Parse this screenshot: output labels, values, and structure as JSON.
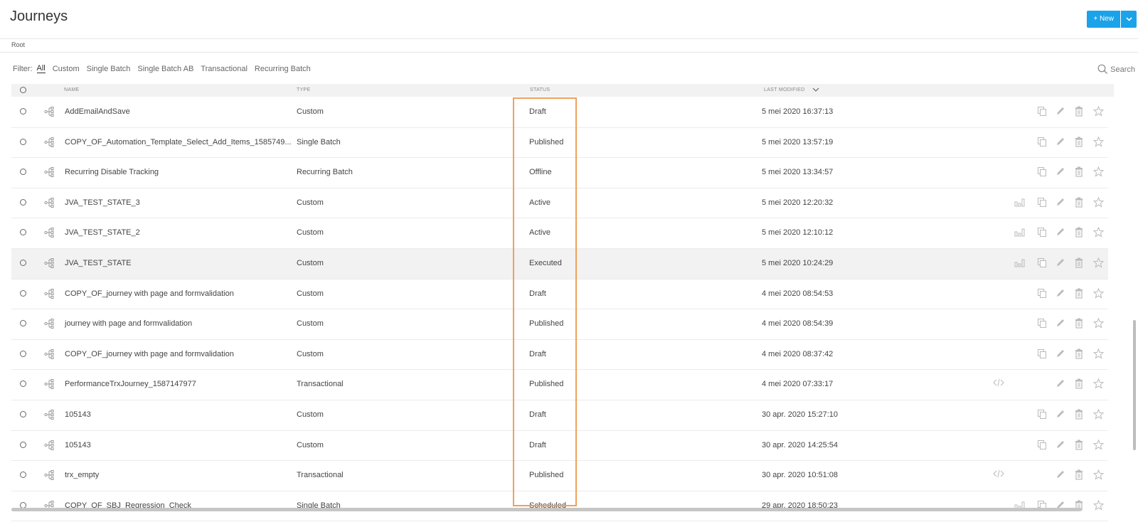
{
  "header": {
    "title": "Journeys",
    "new_button": "+ New"
  },
  "breadcrumb": "Root",
  "filter": {
    "label": "Filter:",
    "options": [
      "All",
      "Custom",
      "Single Batch",
      "Single Batch AB",
      "Transactional",
      "Recurring Batch"
    ],
    "active": "All"
  },
  "search": {
    "label": "Search"
  },
  "columns": {
    "name": "NAME",
    "type": "TYPE",
    "status": "STATUS",
    "last_modified": "LAST MODIFIED"
  },
  "colors": {
    "accent": "#1aa3e8",
    "highlight_box": "#f0a05a"
  },
  "rows": [
    {
      "name": "AddEmailAndSave",
      "type": "Custom",
      "status": "Draft",
      "modified": "5 mei 2020 16:37:13",
      "icons": [
        "copy",
        "edit",
        "delete",
        "star"
      ]
    },
    {
      "name": "COPY_OF_Automation_Template_Select_Add_Items_1585749...",
      "type": "Single Batch",
      "status": "Published",
      "modified": "5 mei 2020 13:57:19",
      "icons": [
        "copy",
        "edit",
        "delete",
        "star"
      ]
    },
    {
      "name": "Recurring Disable Tracking",
      "type": "Recurring Batch",
      "status": "Offline",
      "modified": "5 mei 2020 13:34:57",
      "icons": [
        "copy",
        "edit",
        "delete",
        "star"
      ]
    },
    {
      "name": "JVA_TEST_STATE_3",
      "type": "Custom",
      "status": "Active",
      "modified": "5 mei 2020 12:20:32",
      "icons": [
        "stats",
        "copy",
        "edit",
        "delete",
        "star"
      ]
    },
    {
      "name": "JVA_TEST_STATE_2",
      "type": "Custom",
      "status": "Active",
      "modified": "5 mei 2020 12:10:12",
      "icons": [
        "stats",
        "copy",
        "edit",
        "delete",
        "star"
      ]
    },
    {
      "name": "JVA_TEST_STATE",
      "type": "Custom",
      "status": "Executed",
      "modified": "5 mei 2020 10:24:29",
      "icons": [
        "stats",
        "copy",
        "edit",
        "delete",
        "star"
      ],
      "highlight": true
    },
    {
      "name": "COPY_OF_journey with page and formvalidation",
      "type": "Custom",
      "status": "Draft",
      "modified": "4 mei 2020 08:54:53",
      "icons": [
        "copy",
        "edit",
        "delete",
        "star"
      ]
    },
    {
      "name": "journey with page and formvalidation",
      "type": "Custom",
      "status": "Published",
      "modified": "4 mei 2020 08:54:39",
      "icons": [
        "copy",
        "edit",
        "delete",
        "star"
      ]
    },
    {
      "name": "COPY_OF_journey with page and formvalidation",
      "type": "Custom",
      "status": "Draft",
      "modified": "4 mei 2020 08:37:42",
      "icons": [
        "copy",
        "edit",
        "delete",
        "star"
      ]
    },
    {
      "name": "PerformanceTrxJourney_1587147977",
      "type": "Transactional",
      "status": "Published",
      "modified": "4 mei 2020 07:33:17",
      "icons": [
        "code",
        "edit",
        "delete",
        "star"
      ]
    },
    {
      "name": "105143",
      "type": "Custom",
      "status": "Draft",
      "modified": "30 apr. 2020 15:27:10",
      "icons": [
        "copy",
        "edit",
        "delete",
        "star"
      ]
    },
    {
      "name": "105143",
      "type": "Custom",
      "status": "Draft",
      "modified": "30 apr. 2020 14:25:54",
      "icons": [
        "copy",
        "edit",
        "delete",
        "star"
      ]
    },
    {
      "name": "trx_empty",
      "type": "Transactional",
      "status": "Published",
      "modified": "30 apr. 2020 10:51:08",
      "icons": [
        "code",
        "edit",
        "delete",
        "star"
      ]
    },
    {
      "name": "COPY_OF_SBJ_Regression_Check",
      "type": "Single Batch",
      "status": "Scheduled",
      "modified": "29 apr. 2020 18:50:23",
      "icons": [
        "stats",
        "copy",
        "edit",
        "delete",
        "star"
      ]
    }
  ]
}
